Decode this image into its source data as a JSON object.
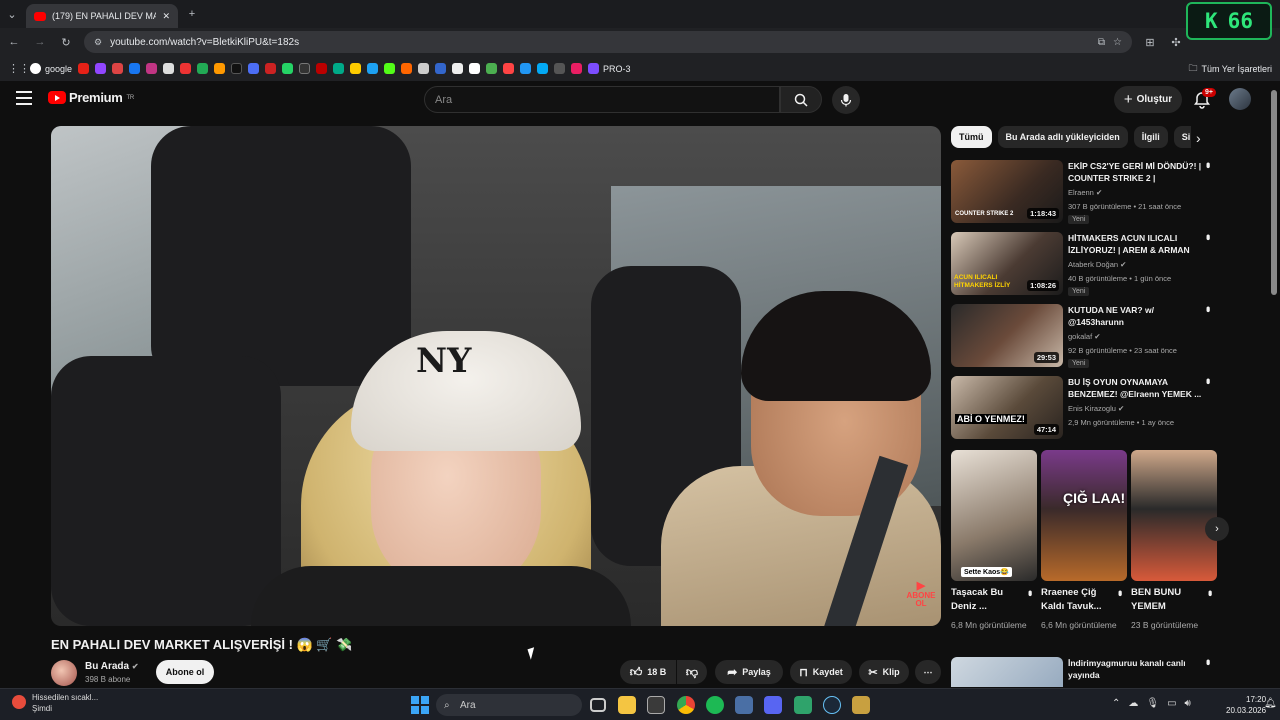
{
  "browser": {
    "tab_title": "(179) EN PAHALI DEV MARKET",
    "url": "youtube.com/watch?v=BletkiKliPU&t=182s",
    "bookmarks": [
      "google",
      "PRO-3"
    ],
    "all_bookmarks": "Tüm Yer İşaretleri"
  },
  "overlay_counter": {
    "letter": "K",
    "value": "66"
  },
  "youtube": {
    "logo_text": "Premium",
    "logo_sup": "TR",
    "search_placeholder": "Ara",
    "create_label": "Oluştur",
    "notif_count": "9+"
  },
  "video": {
    "title": "EN PAHALI DEV MARKET ALIŞVERİŞİ ! 😱 🛒 💸",
    "channel": "Bu Arada",
    "subscribers": "398 B abone",
    "subscribe_label": "Abone ol",
    "likes": "18 B",
    "share_label": "Paylaş",
    "save_label": "Kaydet",
    "clip_label": "Klip",
    "overlay_badge": "ABONE OL"
  },
  "chips": [
    "Tümü",
    "Bu Arada adlı yükleyiciden",
    "İlgili",
    "Si"
  ],
  "recommendations": [
    {
      "title": "EKİP CS2'YE GERİ Mİ DÖNDÜ?! | COUNTER STRIKE 2 |",
      "channel": "Elraenn",
      "meta": "307 B görüntüleme • 21 saat önce",
      "badge": "Yeni",
      "duration": "1:18:43"
    },
    {
      "title": "HİTMAKERS ACUN ILICALI İZLİYORUZ! | AREM & ARMAN",
      "channel": "Ataberk Doğan",
      "meta": "40 B görüntüleme • 1 gün önce",
      "badge": "Yeni",
      "duration": "1:08:26"
    },
    {
      "title": "KUTUDA NE VAR? w/ @1453harunn",
      "channel": "gokalaf",
      "meta": "92 B görüntüleme • 23 saat önce",
      "badge": "Yeni",
      "duration": "29:53"
    },
    {
      "title": "BU İŞ OYUN OYNAMAYA BENZEMEZ! @Elraenn YEMEK ...",
      "channel": "Enis Kirazoglu",
      "meta": "2,9 Mn görüntüleme • 1 ay önce",
      "badge": "",
      "duration": "47:14"
    }
  ],
  "shorts": [
    {
      "title": "Taşacak Bu Deniz ...",
      "views": "6,8 Mn görüntüleme",
      "overlay": "Sette Kaos😂"
    },
    {
      "title": "Rraenee Çiğ Kaldı Tavuk...",
      "views": "6,6 Mn görüntüleme",
      "overlay": "ÇIĞ LAA!"
    },
    {
      "title": "BEN BUNU YEMEM",
      "views": "23 B görüntüleme",
      "overlay": ""
    }
  ],
  "next_rec": {
    "title": "İndirimyagmuruu kanalı canlı yayında"
  },
  "taskbar": {
    "weather_title": "Hissedilen sıcakl...",
    "weather_sub": "Şimdi",
    "search_label": "Ara",
    "time": "17:20",
    "date": "20.03.2026"
  },
  "thumb_text": {
    "rec1": "COUNTER STRIKE 2",
    "rec2": "ACUN ILICALI HİTMAKERS İZLİY",
    "rec4": "ABİ O YENMEZ!"
  }
}
